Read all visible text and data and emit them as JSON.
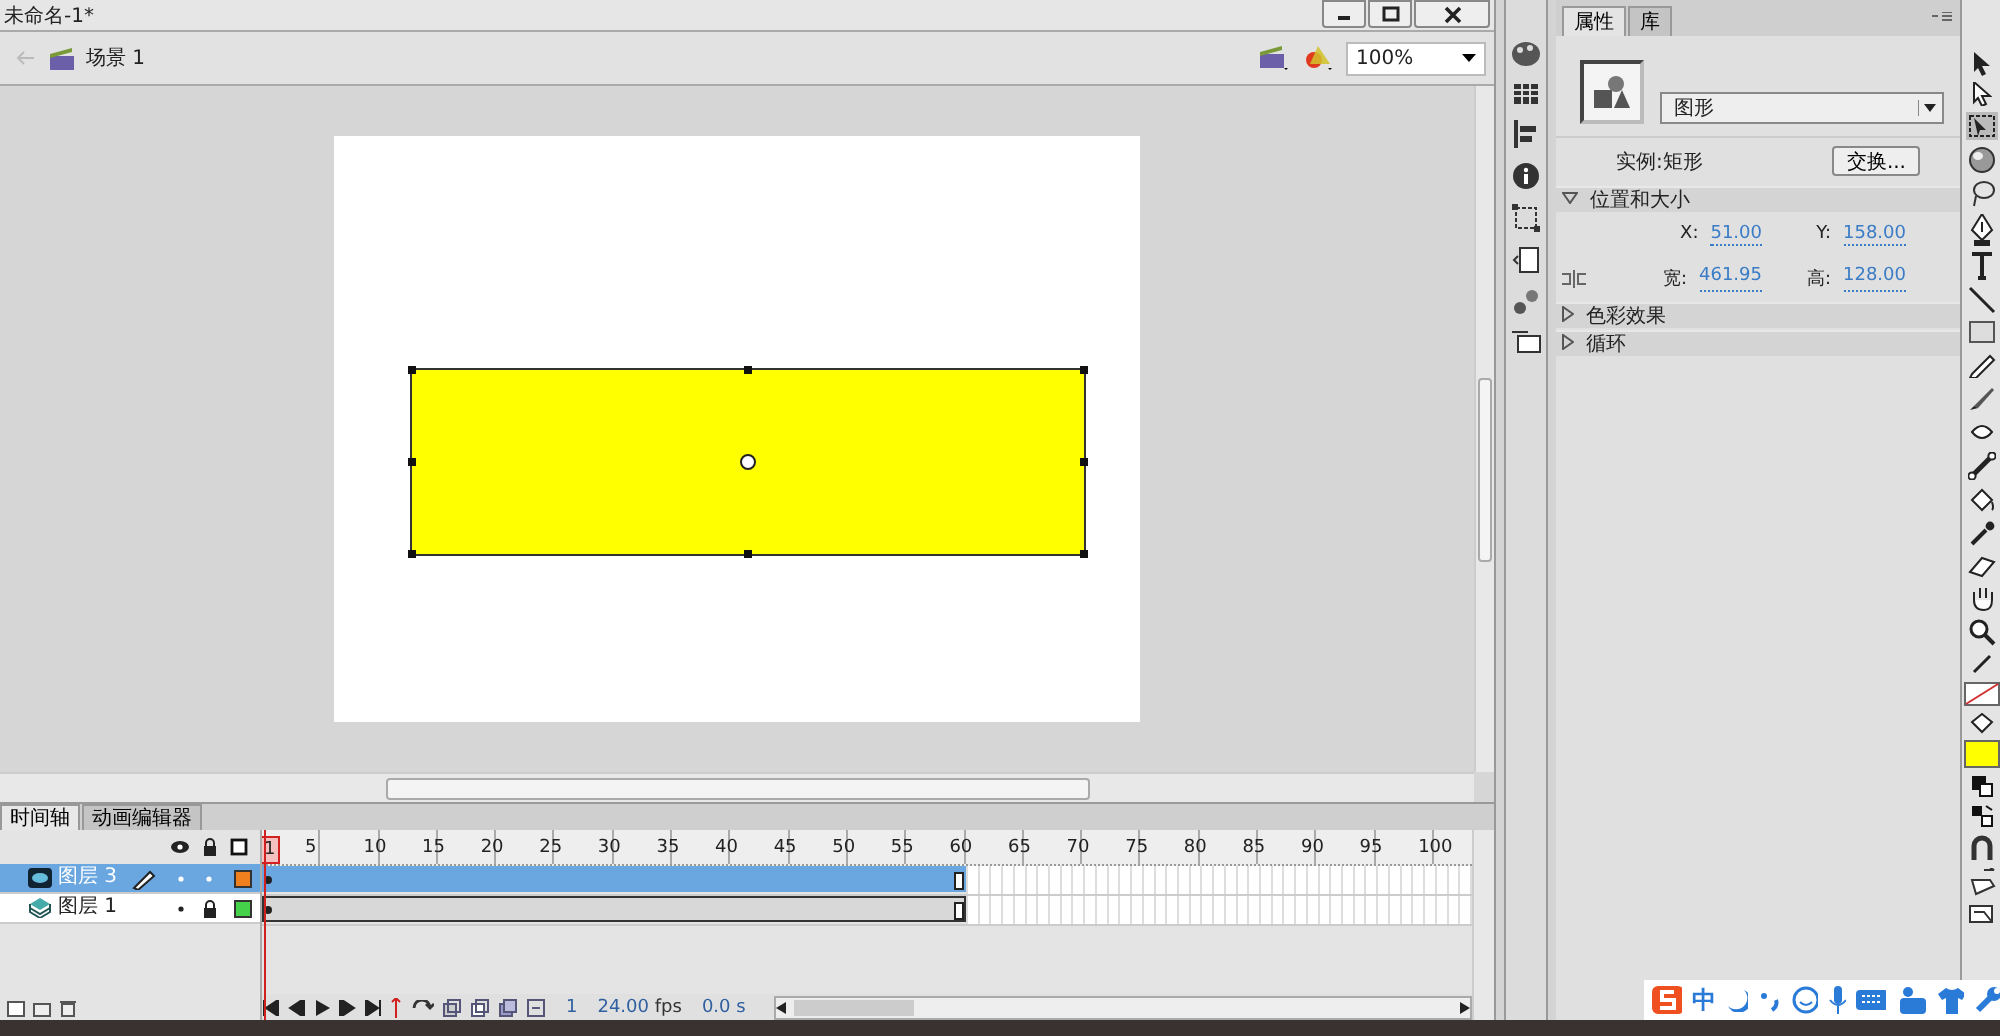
{
  "window": {
    "title": "未命名-1*"
  },
  "edit_bar": {
    "scene": "场景 1",
    "zoom": "100%"
  },
  "timeline": {
    "tabs": [
      {
        "label": "时间轴",
        "selected": true
      },
      {
        "label": "动画编辑器",
        "selected": false
      }
    ],
    "frame_numbers": [
      "1",
      "5",
      "10",
      "15",
      "20",
      "25",
      "30",
      "35",
      "40",
      "45",
      "50",
      "55",
      "60",
      "65",
      "70",
      "75",
      "80",
      "85",
      "90",
      "95",
      "100"
    ],
    "layers": [
      {
        "name": "图层 3",
        "selected": true,
        "locked": false,
        "color": "#f07f1e"
      },
      {
        "name": "图层 1",
        "selected": false,
        "locked": true,
        "color": "#45d24a"
      }
    ],
    "current_frame": "1",
    "fps": "24.00",
    "fps_unit": "fps",
    "time": "0.0 s"
  },
  "properties": {
    "tabs": [
      {
        "label": "属性",
        "selected": true
      },
      {
        "label": "库",
        "selected": false
      }
    ],
    "symbol_type": "图形",
    "instance_label": "实例:",
    "instance_name": "矩形",
    "swap_button": "交换...",
    "sections": [
      {
        "label": "位置和大小",
        "expanded": true,
        "fields": [
          [
            {
              "label": "X:",
              "value": "51.00"
            },
            {
              "label": "Y:",
              "value": "158.00"
            }
          ],
          [
            {
              "label": "宽:",
              "value": "461.95"
            },
            {
              "label": "高:",
              "value": "128.00"
            }
          ]
        ]
      },
      {
        "label": "色彩效果",
        "expanded": false
      },
      {
        "label": "循环",
        "expanded": false
      }
    ]
  },
  "color_swatches": [
    {
      "kind": "stroke"
    },
    {
      "kind": "fill",
      "color": "#ffff00"
    }
  ],
  "ime_bar": {
    "label": "中"
  }
}
